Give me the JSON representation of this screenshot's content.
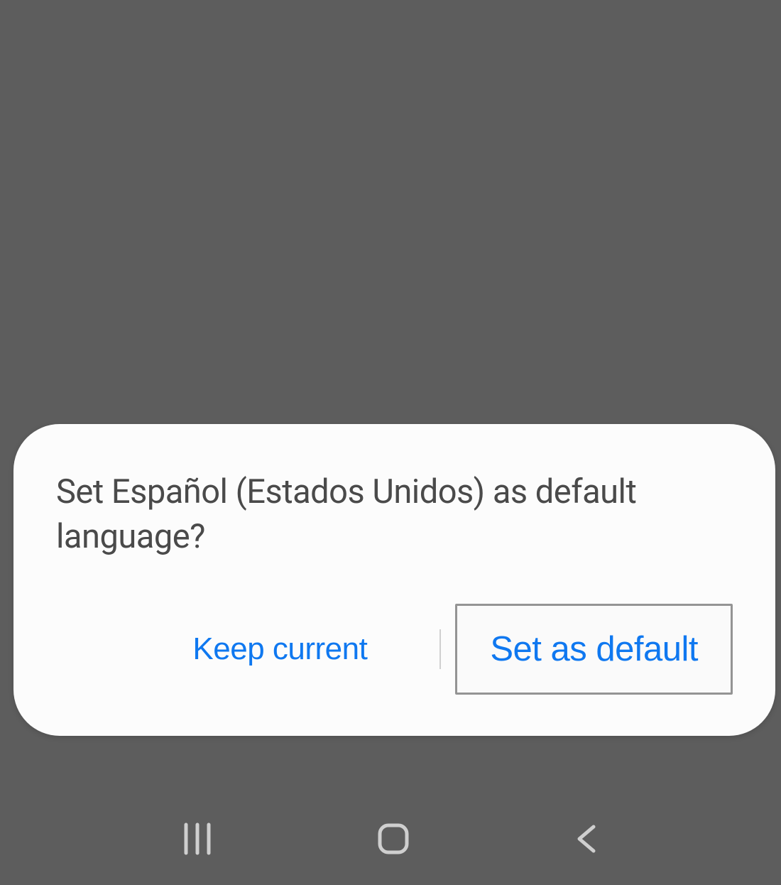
{
  "dialog": {
    "message": "Set Español (Estados Unidos) as default language?",
    "keep_current_label": "Keep current",
    "set_default_label": "Set as default"
  }
}
